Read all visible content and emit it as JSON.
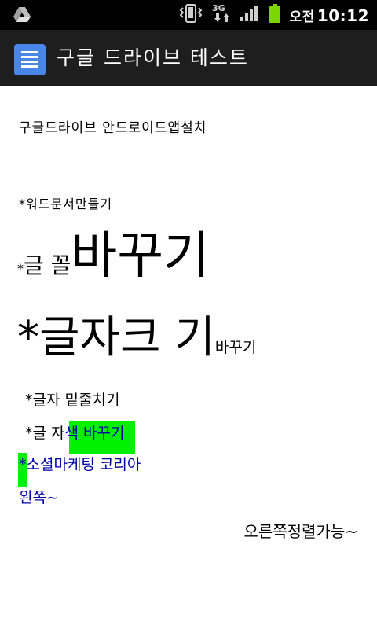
{
  "status_bar": {
    "time_prefix": "오전",
    "time": "10:12",
    "network": "3G",
    "icons": [
      "drive-notification-icon",
      "vibrate-icon",
      "3g-data-icon",
      "signal-icon",
      "battery-icon"
    ],
    "battery_color": "#7dd500"
  },
  "app_bar": {
    "title": "구글 드라이브 테스트",
    "icon": "document-icon",
    "accent": "#4a86e8"
  },
  "document": {
    "line1": "구글드라이브 안드로이드앱설치",
    "line2": "*워드문서만들기",
    "line3": {
      "small": "*",
      "mid": "글 꼴",
      "big": "바꾸기"
    },
    "line4": {
      "big": "*글자크 기",
      "small": "바꾸기"
    },
    "line5": {
      "prefix": "*글자 ",
      "underlined": "밑줄치기"
    },
    "line6": {
      "prefix": "*글 자",
      "highlighted": "색 바꾸기"
    },
    "line7": "*소셜마케팅 코리아",
    "line8": "왼쪽~",
    "line9": "오른쪽정렬가능~",
    "highlight_color": "#00f000",
    "link_color": "#0000a8"
  }
}
